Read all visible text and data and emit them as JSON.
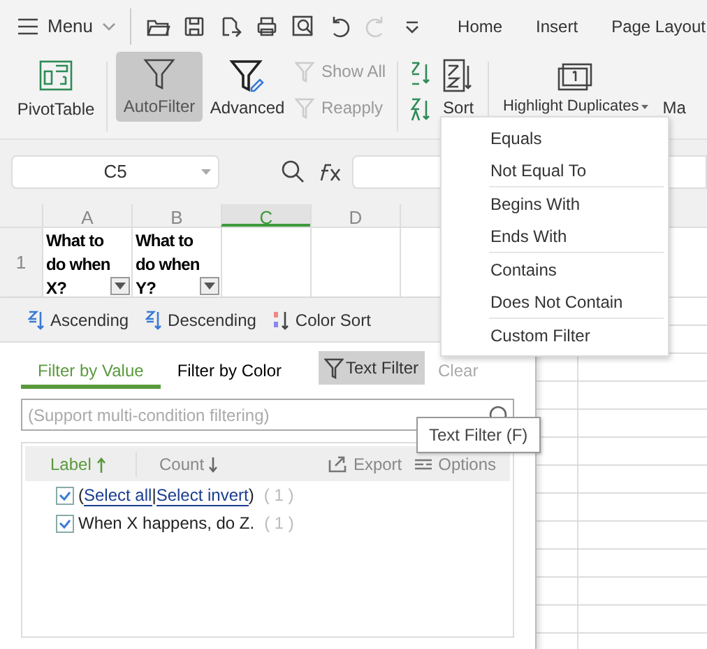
{
  "menubar": {
    "menu_label": "Menu",
    "tabs": [
      {
        "label": "Home"
      },
      {
        "label": "Insert"
      },
      {
        "label": "Page Layout"
      }
    ]
  },
  "ribbon": {
    "pivot": {
      "label": "PivotTable"
    },
    "autofilter": {
      "label": "AutoFilter",
      "selected": true
    },
    "advanced": {
      "label": "Advanced"
    },
    "small_buttons": [
      {
        "label": "Show All",
        "disabled": true
      },
      {
        "label": "Reapply",
        "disabled": true
      }
    ],
    "sort": {
      "label": "Sort"
    },
    "highlight": {
      "label": "Highlight Duplicates"
    },
    "cut_label": "Ma"
  },
  "formula_bar": {
    "name_box": "C5"
  },
  "sheet": {
    "columns": [
      {
        "label": "A",
        "selected": false
      },
      {
        "label": "B",
        "selected": false
      },
      {
        "label": "C",
        "selected": true
      },
      {
        "label": "D",
        "selected": false
      }
    ],
    "rows": [
      {
        "header": "1",
        "cells": [
          "What to do when X?",
          "What to do when Y?"
        ]
      }
    ]
  },
  "filter_panel": {
    "sort_buttons": [
      "Ascending",
      "Descending",
      "Color Sort"
    ],
    "tabs": [
      {
        "label": "Filter by Value",
        "selected": true
      },
      {
        "label": "Filter by Color",
        "selected": false
      }
    ],
    "text_filter": "Text Filter",
    "clear": "Clear",
    "search": {
      "placeholder": "(Support multi-condition filtering)"
    },
    "list_header": {
      "label": "Label",
      "count": "Count",
      "export": "Export",
      "options": "Options"
    },
    "items": [
      {
        "checked": true,
        "count": "( 1 )",
        "parts": [
          {
            "kind": "text",
            "text": "("
          },
          {
            "kind": "link",
            "text": "Select all"
          },
          {
            "kind": "text",
            "text": "|"
          },
          {
            "kind": "link",
            "text": "Select invert"
          },
          {
            "kind": "text",
            "text": ")"
          }
        ]
      },
      {
        "checked": true,
        "count": "( 1 )",
        "parts": [
          {
            "kind": "text",
            "text": "When X happens, do Z."
          }
        ]
      }
    ]
  },
  "text_filter_menu": {
    "groups": [
      [
        "Equals",
        "Not Equal To"
      ],
      [
        "Begins With",
        "Ends With"
      ],
      [
        "Contains",
        "Does Not Contain"
      ],
      [
        "Custom Filter"
      ]
    ]
  },
  "tooltip": "Text Filter (F)"
}
